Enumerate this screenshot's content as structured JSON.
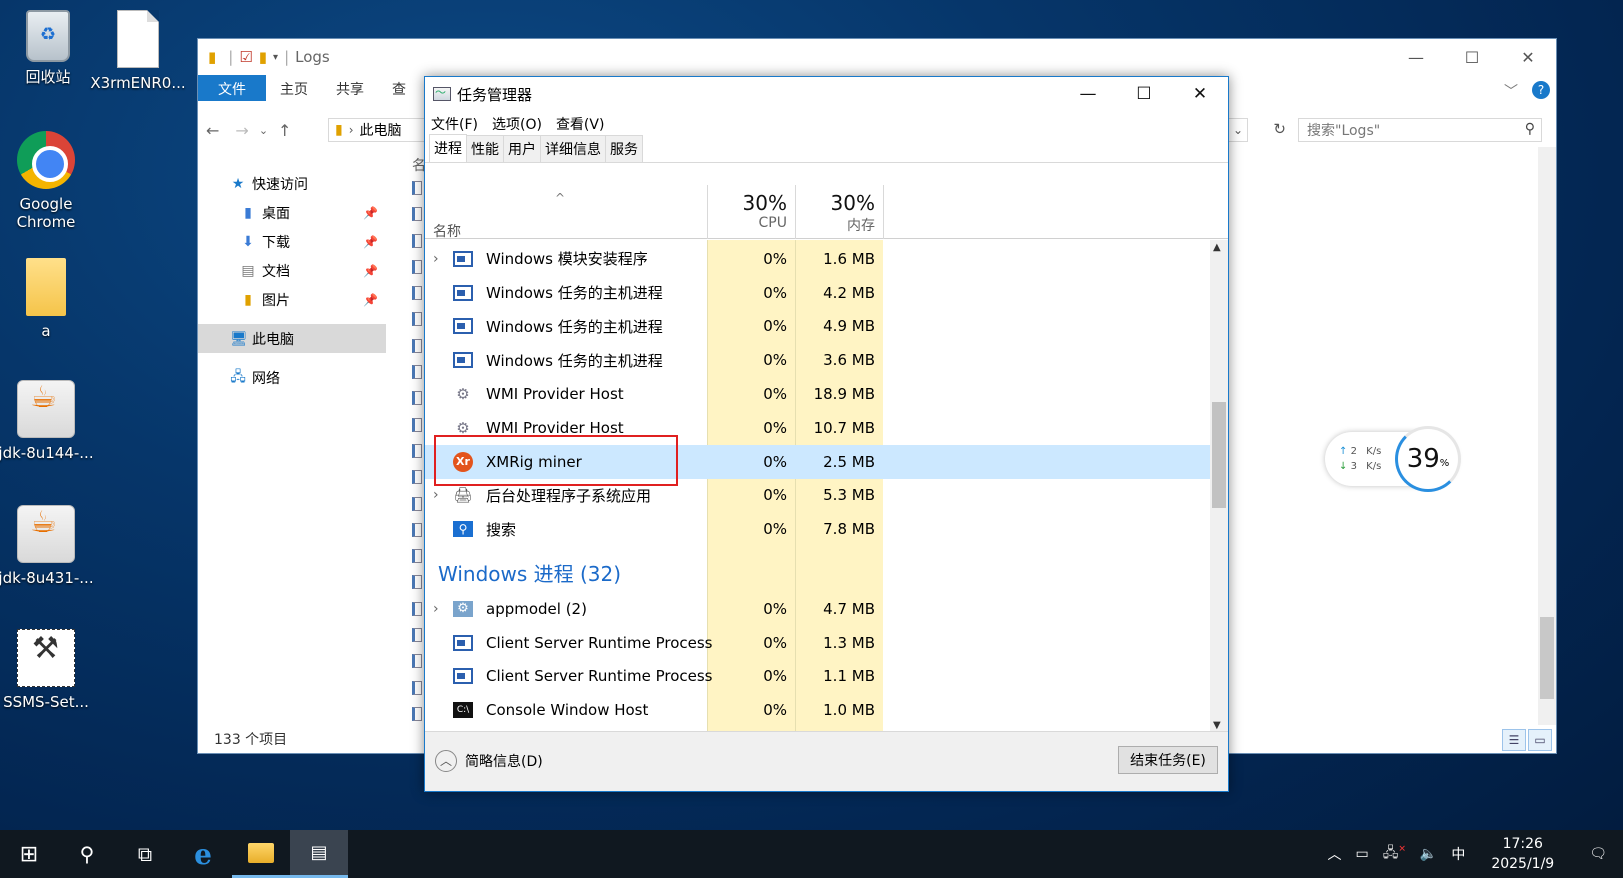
{
  "desktop": {
    "icons": [
      {
        "label": "回收站",
        "icon": "recycle-bin-icon"
      },
      {
        "label": "X3rmENR0...",
        "icon": "document-icon"
      },
      {
        "label": "Google\nChrome",
        "icon": "chrome-icon"
      },
      {
        "label": "a",
        "icon": "folder-icon"
      },
      {
        "label": "jdk-8u144-...",
        "icon": "java-installer-icon"
      },
      {
        "label": "jdk-8u431-...",
        "icon": "java-installer-icon"
      },
      {
        "label": "SSMS-Set...",
        "icon": "ssms-setup-icon"
      }
    ]
  },
  "explorer": {
    "title": "Logs",
    "ribbon_tabs": [
      "文件",
      "主页",
      "共享",
      "查"
    ],
    "address": "此电脑",
    "search_placeholder": "搜索\"Logs\"",
    "column_fragment": "名",
    "nav": {
      "quick_access": "快速访问",
      "items": [
        {
          "label": "桌面",
          "pinned": true
        },
        {
          "label": "下载",
          "pinned": true
        },
        {
          "label": "文档",
          "pinned": true
        },
        {
          "label": "图片",
          "pinned": true
        }
      ],
      "this_pc": "此电脑",
      "network": "网络"
    },
    "status": "133 个项目"
  },
  "taskmgr": {
    "title": "任务管理器",
    "menu": [
      "文件(F)",
      "选项(O)",
      "查看(V)"
    ],
    "tabs": [
      "进程",
      "性能",
      "用户",
      "详细信息",
      "服务"
    ],
    "active_tab": "进程",
    "columns": {
      "name": "名称",
      "cpu_pct": "30%",
      "cpu": "CPU",
      "mem_pct": "30%",
      "mem": "内存"
    },
    "rows": [
      {
        "name": "Windows 模块安装程序",
        "cpu": "0%",
        "mem": "1.6 MB",
        "icon": "windows-app-icon",
        "expandable": true
      },
      {
        "name": "Windows 任务的主机进程",
        "cpu": "0%",
        "mem": "4.2 MB",
        "icon": "windows-app-icon"
      },
      {
        "name": "Windows 任务的主机进程",
        "cpu": "0%",
        "mem": "4.9 MB",
        "icon": "windows-app-icon"
      },
      {
        "name": "Windows 任务的主机进程",
        "cpu": "0%",
        "mem": "3.6 MB",
        "icon": "windows-app-icon"
      },
      {
        "name": "WMI Provider Host",
        "cpu": "0%",
        "mem": "18.9 MB",
        "icon": "wmi-icon"
      },
      {
        "name": "WMI Provider Host",
        "cpu": "0%",
        "mem": "10.7 MB",
        "icon": "wmi-icon"
      },
      {
        "name": "XMRig miner",
        "cpu": "0%",
        "mem": "2.5 MB",
        "icon": "xmrig-icon",
        "highlighted": true
      },
      {
        "name": "后台处理程序子系统应用",
        "cpu": "0%",
        "mem": "5.3 MB",
        "icon": "printer-icon",
        "expandable": true
      },
      {
        "name": "搜索",
        "cpu": "0%",
        "mem": "7.8 MB",
        "icon": "search-icon"
      }
    ],
    "group_label": "Windows 进程 (32)",
    "group_rows": [
      {
        "name": "appmodel (2)",
        "cpu": "0%",
        "mem": "4.7 MB",
        "icon": "gear-icon",
        "expandable": true
      },
      {
        "name": "Client Server Runtime Process",
        "cpu": "0%",
        "mem": "1.3 MB",
        "icon": "windows-app-icon"
      },
      {
        "name": "Client Server Runtime Process",
        "cpu": "0%",
        "mem": "1.1 MB",
        "icon": "windows-app-icon"
      },
      {
        "name": "Console Window Host",
        "cpu": "0%",
        "mem": "1.0 MB",
        "icon": "console-icon"
      }
    ],
    "fewer_details": "简略信息(D)",
    "end_task": "结束任务(E)"
  },
  "net_widget": {
    "up_rate": "2",
    "down_rate": "3",
    "unit": "K/s",
    "usage": "39",
    "usage_unit": "%"
  },
  "taskbar": {
    "ime": "中",
    "time": "17:26",
    "date": "2025/1/9"
  },
  "colors": {
    "accent": "#1979ca",
    "cpu_mem_column_bg": "#fff4c4",
    "selected_row_bg": "#cce8ff",
    "highlight_box": "#e02020"
  }
}
